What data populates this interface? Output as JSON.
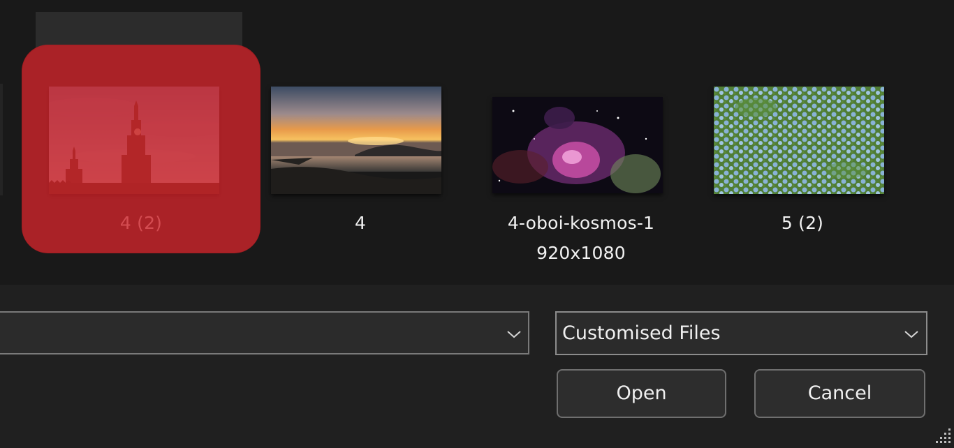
{
  "files": [
    {
      "name": "4 (2)",
      "selected": true,
      "image": "kremlin-tower"
    },
    {
      "name": "4",
      "selected": false,
      "image": "sunset-lake"
    },
    {
      "name": "4-oboi-kosmos-1920x1080",
      "name_line1": "4-oboi-kosmos-1",
      "name_line2": "920x1080",
      "selected": false,
      "image": "space-nebula"
    },
    {
      "name": "5 (2)",
      "selected": false,
      "image": "blue-flowers"
    }
  ],
  "file_name_input": {
    "value": "",
    "icon": "chevron-down-icon"
  },
  "file_type_select": {
    "value": "Customised Files",
    "icon": "chevron-down-icon"
  },
  "buttons": {
    "open": "Open",
    "cancel": "Cancel"
  },
  "colors": {
    "highlight": "#cc1e24",
    "background": "#191919",
    "bar": "#202020"
  }
}
